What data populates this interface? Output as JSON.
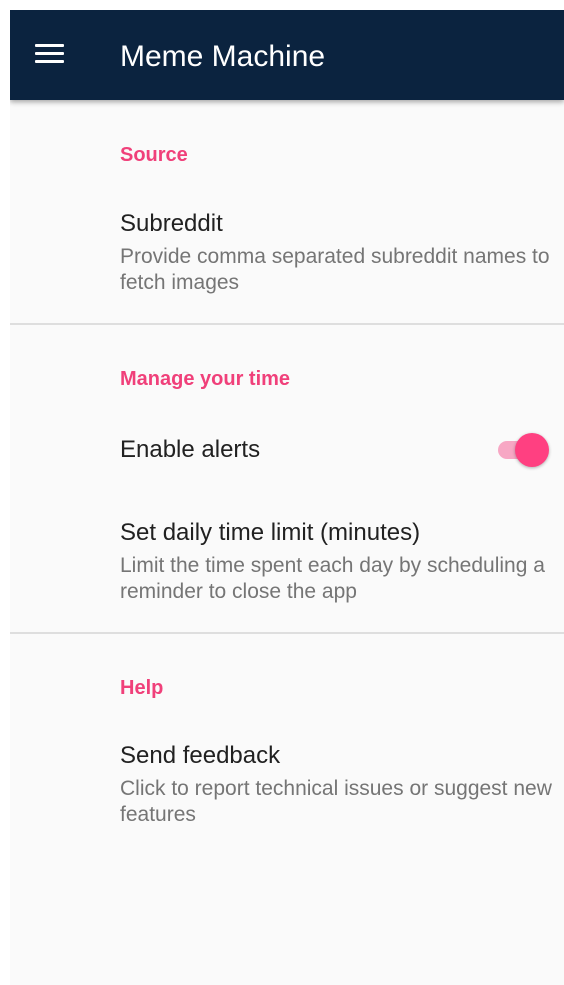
{
  "app_bar": {
    "title": "Meme Machine",
    "menu_icon": "hamburger-menu-icon",
    "background_color": "#0b233f"
  },
  "colors": {
    "accent": "#ff4081",
    "category_text": "#f0407a",
    "summary_text": "#757575",
    "title_text": "#212121",
    "background": "#fafafa"
  },
  "categories": [
    {
      "title": "Source",
      "preferences": [
        {
          "title": "Subreddit",
          "summary": "Provide comma separated subreddit names to fetch images"
        }
      ]
    },
    {
      "title": "Manage your time",
      "preferences": [
        {
          "title": "Enable alerts",
          "switch_on": true
        },
        {
          "title": "Set daily time limit (minutes)",
          "summary": "Limit the time spent each day by scheduling a reminder to close the app"
        }
      ]
    },
    {
      "title": "Help",
      "preferences": [
        {
          "title": "Send feedback",
          "summary": "Click to report technical issues or suggest new features"
        }
      ]
    }
  ]
}
